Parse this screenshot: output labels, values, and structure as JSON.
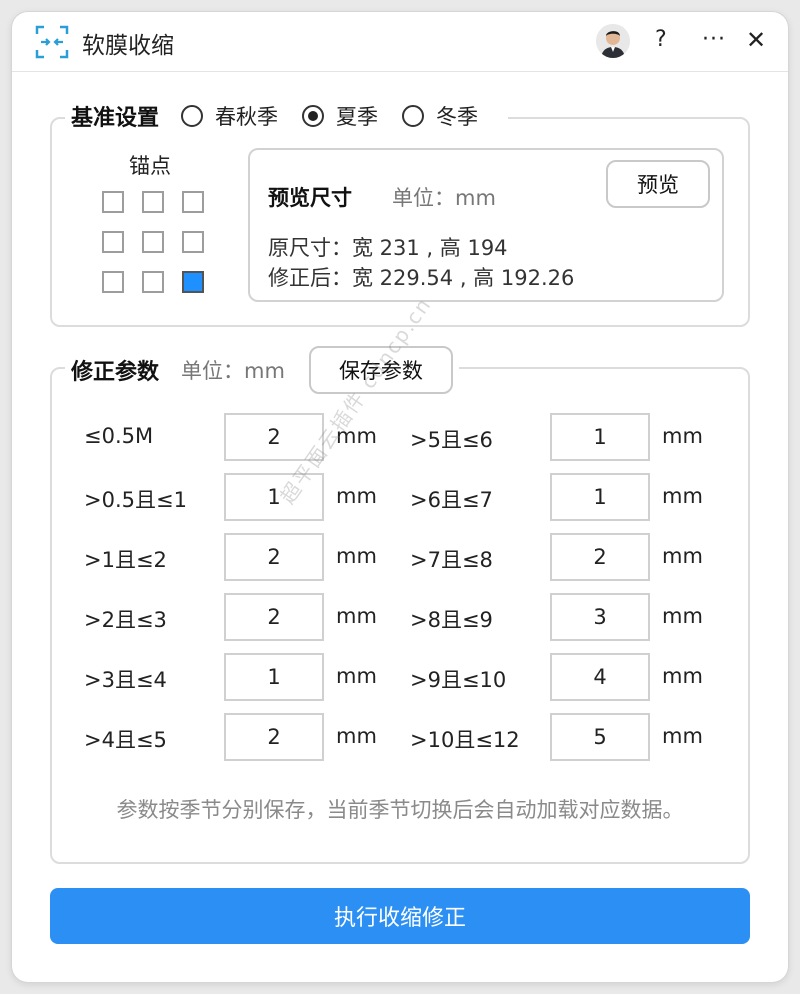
{
  "window": {
    "title": "软膜收缩",
    "help_label": "?",
    "more_label": "···",
    "close_label": "✕"
  },
  "base_settings": {
    "title": "基准设置",
    "seasons": [
      {
        "label": "春秋季",
        "selected": false
      },
      {
        "label": "夏季",
        "selected": true
      },
      {
        "label": "冬季",
        "selected": false
      }
    ],
    "anchor_label": "锚点",
    "anchor_selected": "bottom-right"
  },
  "preview": {
    "title": "预览尺寸",
    "unit": "单位：mm",
    "button_label": "预览",
    "original": "原尺寸：宽 231 , 高 194",
    "corrected": "修正后：宽 229.54 , 高 192.26"
  },
  "correction": {
    "title": "修正参数",
    "unit": "单位：mm",
    "save_label": "保存参数",
    "unit_suffix": "mm",
    "left": [
      {
        "range": "≤0.5M",
        "value": "2"
      },
      {
        "range": ">0.5且≤1",
        "value": "1"
      },
      {
        "range": ">1且≤2",
        "value": "2"
      },
      {
        "range": ">2且≤3",
        "value": "2"
      },
      {
        "range": ">3且≤4",
        "value": "1"
      },
      {
        "range": ">4且≤5",
        "value": "2"
      }
    ],
    "right": [
      {
        "range": ">5且≤6",
        "value": "1"
      },
      {
        "range": ">6且≤7",
        "value": "1"
      },
      {
        "range": ">7且≤8",
        "value": "2"
      },
      {
        "range": ">8且≤9",
        "value": "3"
      },
      {
        "range": ">9且≤10",
        "value": "4"
      },
      {
        "range": ">10且≤12",
        "value": "5"
      }
    ],
    "note": "参数按季节分别保存，当前季节切换后会自动加载对应数据。"
  },
  "execute_label": "执行收缩修正",
  "watermark": "超平面云插件 cdncp.cn",
  "colors": {
    "accent": "#2b8ff4",
    "anchor_selected": "#1e90ff"
  }
}
